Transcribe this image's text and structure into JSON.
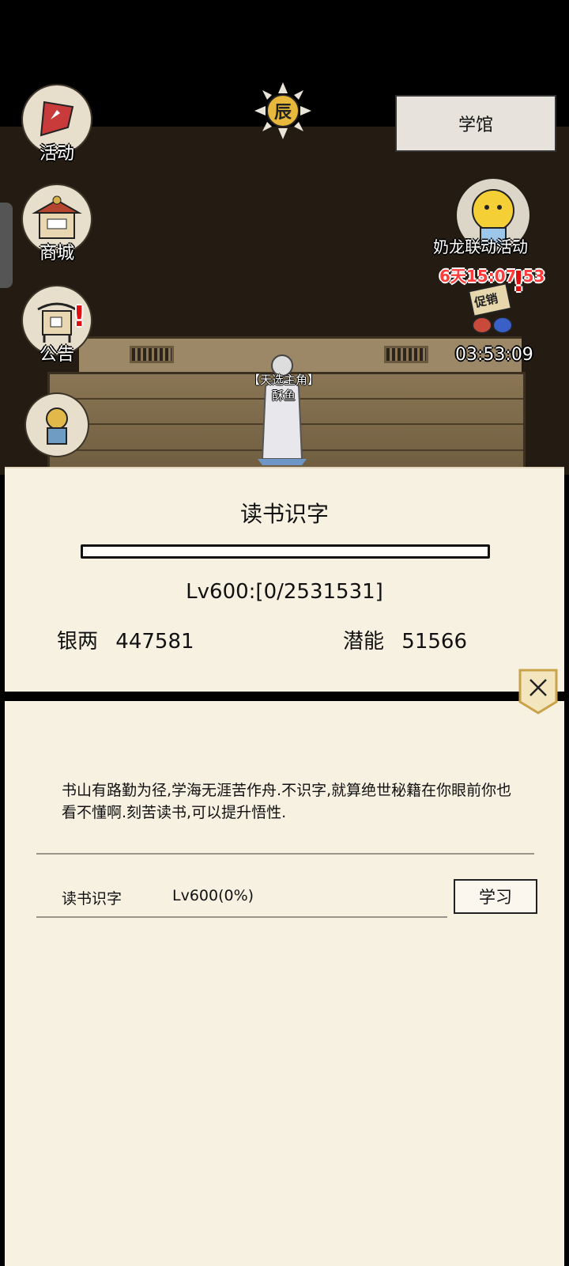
{
  "menu": {
    "activity": "活动",
    "shop": "商城",
    "notice": "公告"
  },
  "hud": {
    "time_char": "辰",
    "location": "学馆"
  },
  "event": {
    "title": "奶龙联动活动",
    "timer": "6天15:07:53",
    "promo_sign": "促销",
    "promo_timer": "03:53:09"
  },
  "player": {
    "title": "【天选主角】",
    "name": "酥鱼"
  },
  "panel": {
    "title": "读书识字",
    "progress_fraction": 0,
    "level_text": "Lv600:[0/2531531]",
    "silver_label": "银两",
    "silver_value": "447581",
    "potential_label": "潜能",
    "potential_value": "51566",
    "description": "书山有路勤为径,学海无涯苦作舟.不识字,就算绝世秘籍在你眼前你也看不懂啊.刻苦读书,可以提升悟性.",
    "skill_name": "读书识字",
    "skill_level": "Lv600(0%)",
    "learn_button": "学习"
  },
  "colors": {
    "panel_bg": "#f7f1e2",
    "timer_red": "#ff3b3b"
  }
}
